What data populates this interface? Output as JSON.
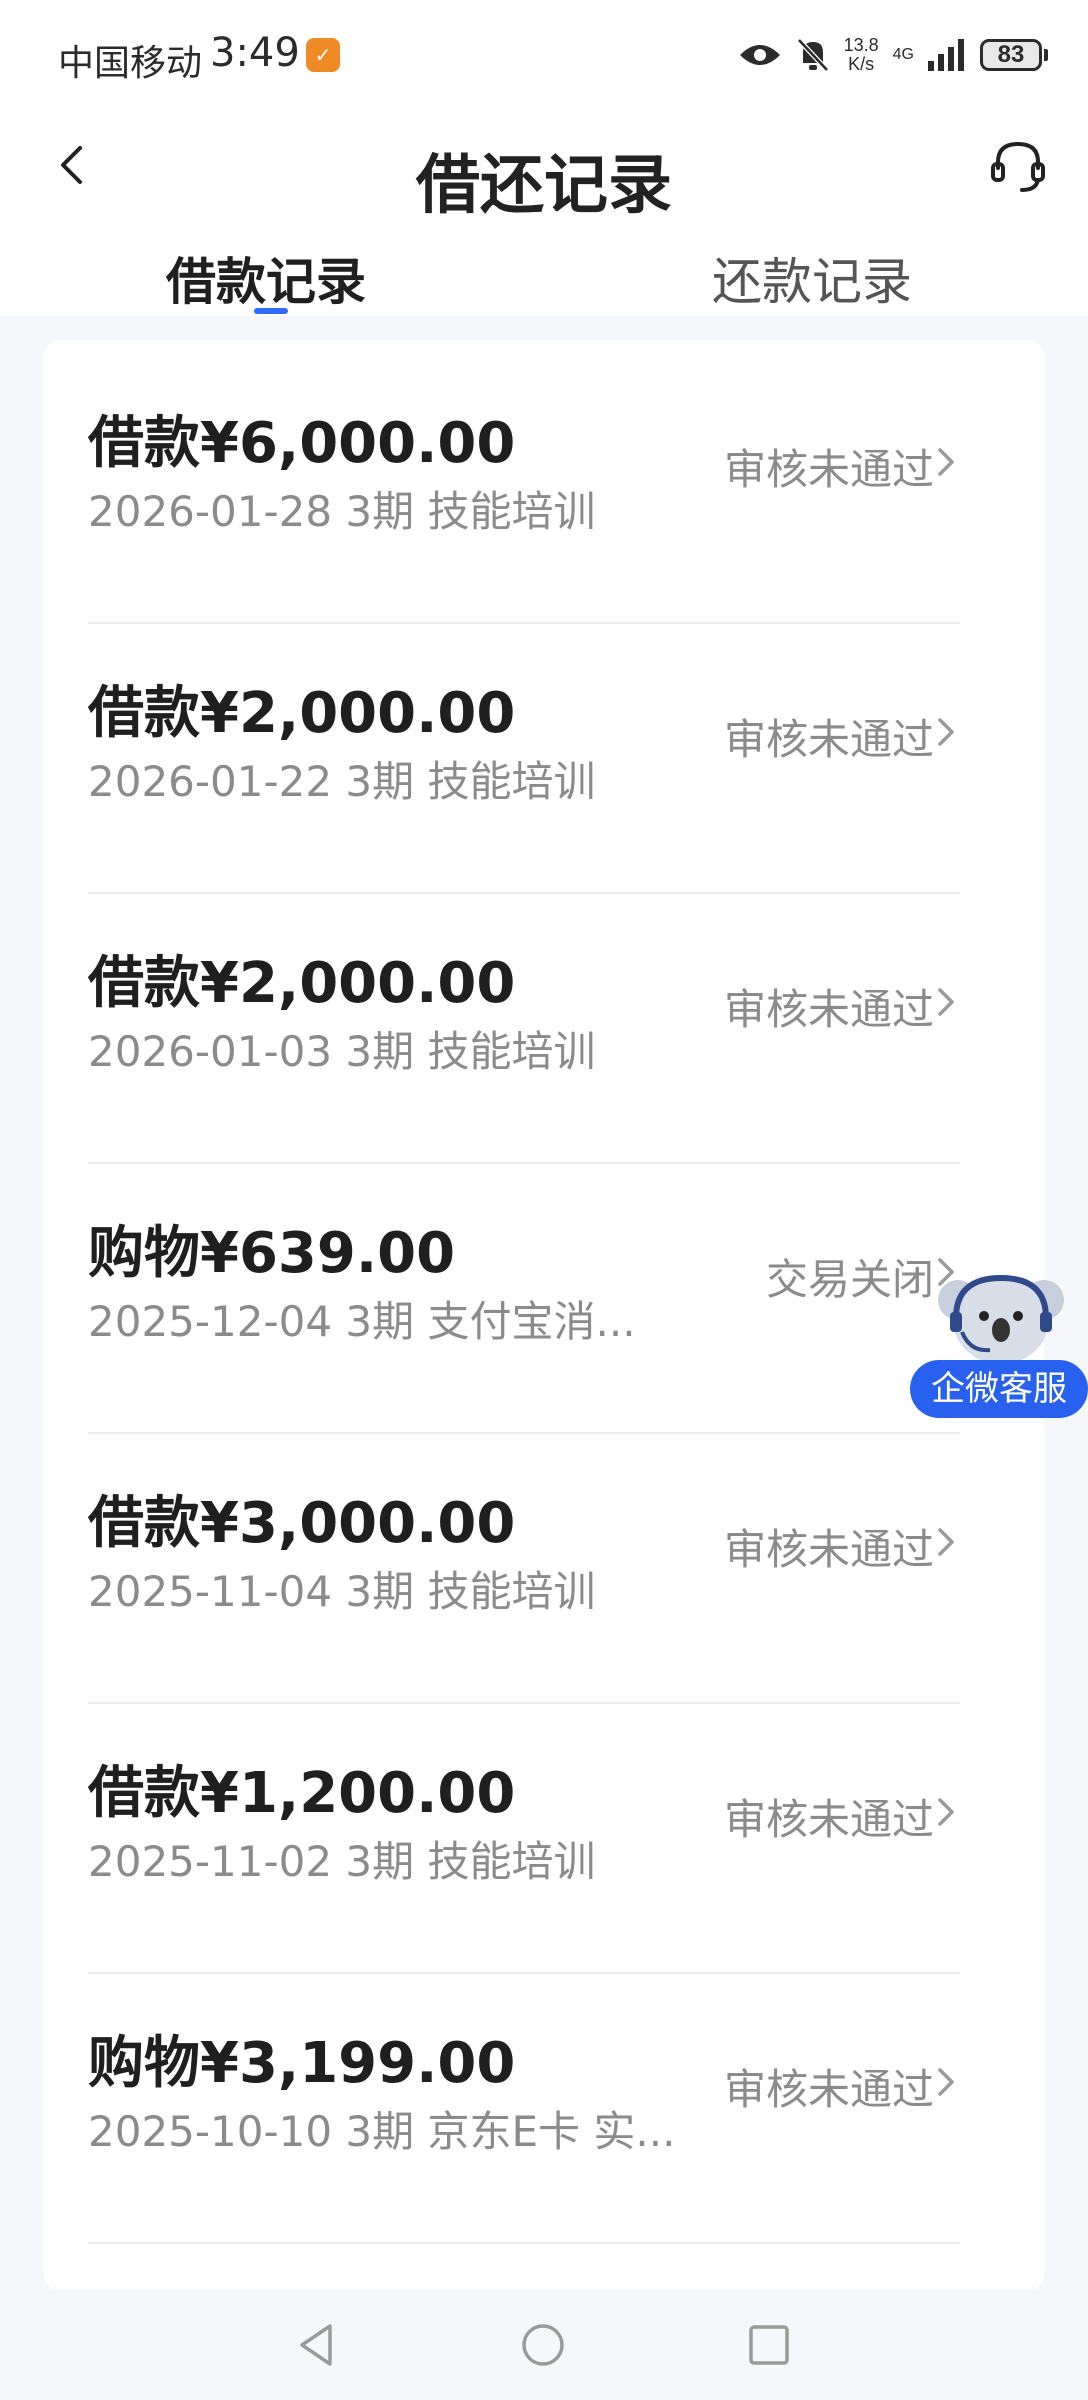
{
  "status_bar": {
    "carrier": "中国移动",
    "time": "3:49",
    "net_speed_value": "13.8",
    "net_speed_unit": "K/s",
    "network": "4G",
    "battery": "83"
  },
  "header": {
    "title": "借还记录"
  },
  "tabs": [
    {
      "label": "借款记录",
      "active": true
    },
    {
      "label": "还款记录",
      "active": false
    }
  ],
  "records": [
    {
      "title": "借款¥6,000.00",
      "subtitle": "2026-01-28 3期  技能培训",
      "status": "审核未通过"
    },
    {
      "title": "借款¥2,000.00",
      "subtitle": "2026-01-22 3期  技能培训",
      "status": "审核未通过"
    },
    {
      "title": "借款¥2,000.00",
      "subtitle": "2026-01-03 3期  技能培训",
      "status": "审核未通过"
    },
    {
      "title": "购物¥639.00",
      "subtitle": "2025-12-04 3期  支付宝消...",
      "status": "交易关闭"
    },
    {
      "title": "借款¥3,000.00",
      "subtitle": "2025-11-04 3期  技能培训",
      "status": "审核未通过"
    },
    {
      "title": "借款¥1,200.00",
      "subtitle": "2025-11-02 3期  技能培训",
      "status": "审核未通过"
    },
    {
      "title": "购物¥3,199.00",
      "subtitle": "2025-10-10 3期  京东E卡 实...",
      "status": "审核未通过"
    }
  ],
  "floating_service": {
    "label": "企微客服",
    "icon": "koala-avatar-icon"
  },
  "colors": {
    "accent": "#2f6bff",
    "service_badge": "#2860f0",
    "status_text": "#8b8b8b"
  }
}
